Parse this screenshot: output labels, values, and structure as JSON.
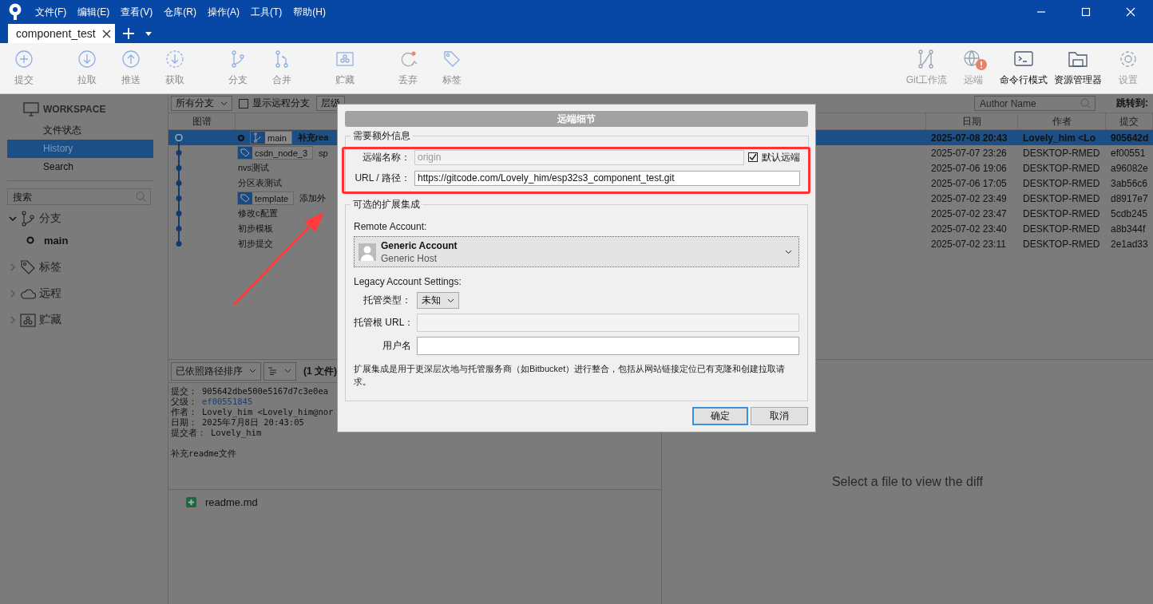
{
  "window": {
    "menu": [
      "文件(F)",
      "编辑(E)",
      "查看(V)",
      "仓库(R)",
      "操作(A)",
      "工具(T)",
      "帮助(H)"
    ]
  },
  "tabs": [
    {
      "label": "component_test",
      "selected": true
    }
  ],
  "toolbar": {
    "left_groups": [
      [
        {
          "kind": "commit",
          "label": "提交"
        }
      ],
      [
        {
          "kind": "pull",
          "label": "拉取"
        },
        {
          "kind": "push",
          "label": "推送"
        },
        {
          "kind": "fetch",
          "label": "获取"
        }
      ],
      [
        {
          "kind": "branch",
          "label": "分支"
        },
        {
          "kind": "merge",
          "label": "合并"
        }
      ],
      [
        {
          "kind": "stash",
          "label": "贮藏"
        }
      ],
      [
        {
          "kind": "discard",
          "label": "丢弃"
        },
        {
          "kind": "tag",
          "label": "标签"
        }
      ]
    ],
    "right": [
      {
        "kind": "flow",
        "label": "Git工作流",
        "disabled": true,
        "alert": false
      },
      {
        "kind": "remote",
        "label": "远端",
        "disabled": true,
        "alert": true
      },
      {
        "kind": "terminal",
        "label": "命令行模式",
        "disabled": false,
        "alert": false
      },
      {
        "kind": "explorer",
        "label": "资源管理器",
        "disabled": false,
        "alert": false
      },
      {
        "kind": "settings",
        "label": "设置",
        "disabled": true,
        "alert": false
      }
    ]
  },
  "sidebar": {
    "workspace": {
      "title": "WORKSPACE",
      "items": [
        {
          "label": "文件状态",
          "selected": false
        },
        {
          "label": "History",
          "selected": true
        },
        {
          "label": "Search",
          "selected": false
        }
      ]
    },
    "search": {
      "placeholder": "搜索"
    },
    "sections": [
      {
        "kind": "branches",
        "label": "分支",
        "expanded": true,
        "children": [
          {
            "label": "main",
            "current": true
          }
        ]
      },
      {
        "kind": "tags",
        "label": "标签",
        "expanded": false
      },
      {
        "kind": "remotes",
        "label": "远程",
        "expanded": false
      },
      {
        "kind": "stashes",
        "label": "贮藏",
        "expanded": false
      }
    ]
  },
  "history": {
    "branch_filter": "所有分支",
    "show_remote": {
      "label": "显示远程分支",
      "checked": false
    },
    "order": "层级",
    "author_search": {
      "placeholder": "Author Name"
    },
    "jump_label": "跳转到:",
    "columns": [
      "图谱",
      "日期",
      "作者",
      "提交"
    ],
    "rows": [
      {
        "head": true,
        "selected": true,
        "tags": [
          {
            "kind": "branch",
            "label": "main"
          }
        ],
        "message": "补充rea",
        "date": "2025-07-08 20:43",
        "author": "Lovely_him <Lo",
        "hash": "905642d"
      },
      {
        "head": false,
        "selected": false,
        "tags": [
          {
            "kind": "tag",
            "label": "csdn_node_3"
          }
        ],
        "message": "sp",
        "date": "2025-07-07 23:26",
        "author": "DESKTOP-RMED",
        "hash": "ef00551"
      },
      {
        "head": false,
        "selected": false,
        "tags": [],
        "message": "nvs测试",
        "date": "2025-07-06 19:06",
        "author": "DESKTOP-RMED",
        "hash": "a96082e"
      },
      {
        "head": false,
        "selected": false,
        "tags": [],
        "message": "分区表测试",
        "date": "2025-07-06 17:05",
        "author": "DESKTOP-RMED",
        "hash": "3ab56c6"
      },
      {
        "head": false,
        "selected": false,
        "tags": [
          {
            "kind": "tag",
            "label": "template"
          }
        ],
        "message": "添加外",
        "date": "2025-07-02 23:49",
        "author": "DESKTOP-RMED",
        "hash": "d8917e7"
      },
      {
        "head": false,
        "selected": false,
        "tags": [],
        "message": "修改c配置",
        "date": "2025-07-02 23:47",
        "author": "DESKTOP-RMED",
        "hash": "5cdb245"
      },
      {
        "head": false,
        "selected": false,
        "tags": [],
        "message": "初步模板",
        "date": "2025-07-02 23:40",
        "author": "DESKTOP-RMED",
        "hash": "a8b344f"
      },
      {
        "head": false,
        "selected": false,
        "tags": [],
        "message": "初步提交",
        "date": "2025-07-02 23:11",
        "author": "DESKTOP-RMED",
        "hash": "2e1ad33"
      }
    ]
  },
  "details": {
    "sort": "已依照路径排序",
    "file_count": "(1 文件)",
    "fields": [
      {
        "label": "提交：",
        "value": "905642dbe500e5167d7c3e0ea",
        "link": false
      },
      {
        "label": "父级：",
        "value": "ef00551845",
        "link": true
      },
      {
        "label": "作者：",
        "value": "Lovely_him <Lovely_him@nor",
        "link": false
      },
      {
        "label": "日期：",
        "value": "2025年7月8日 20:43:05",
        "link": false
      },
      {
        "label": "提交者：",
        "value": "Lovely_him",
        "link": false
      }
    ],
    "message": "补充readme文件",
    "files": [
      {
        "name": "readme.md",
        "kind": "added"
      }
    ]
  },
  "diff": {
    "empty_message": "Select a file to view the diff"
  },
  "dialog": {
    "title": "远端细节",
    "required": {
      "legend": "需要额外信息",
      "name_label": "远端名称：",
      "name_value": "origin",
      "name_disabled": true,
      "default_remote": {
        "label": "默认远端",
        "checked": true
      },
      "url_label": "URL / 路径：",
      "url_value": "https://gitcode.com/Lovely_him/esp32s3_component_test.git"
    },
    "optional": {
      "legend": "可选的扩展集成",
      "account_label": "Remote Account:",
      "account": {
        "name": "Generic Account",
        "host": "Generic Host"
      },
      "legacy_label": "Legacy Account Settings:",
      "host_type_label": "托管类型：",
      "host_type": "未知",
      "root_url_label": "托管根 URL：",
      "root_url_disabled": true,
      "username_label": "用户名",
      "note": "扩展集成是用于更深层次地与托管服务商（如Bitbucket）进行整合，包括从网站链接定位已有克隆和创建拉取请求。"
    },
    "buttons": [
      {
        "label": "确定",
        "default": true
      },
      {
        "label": "取消",
        "default": false
      }
    ]
  }
}
